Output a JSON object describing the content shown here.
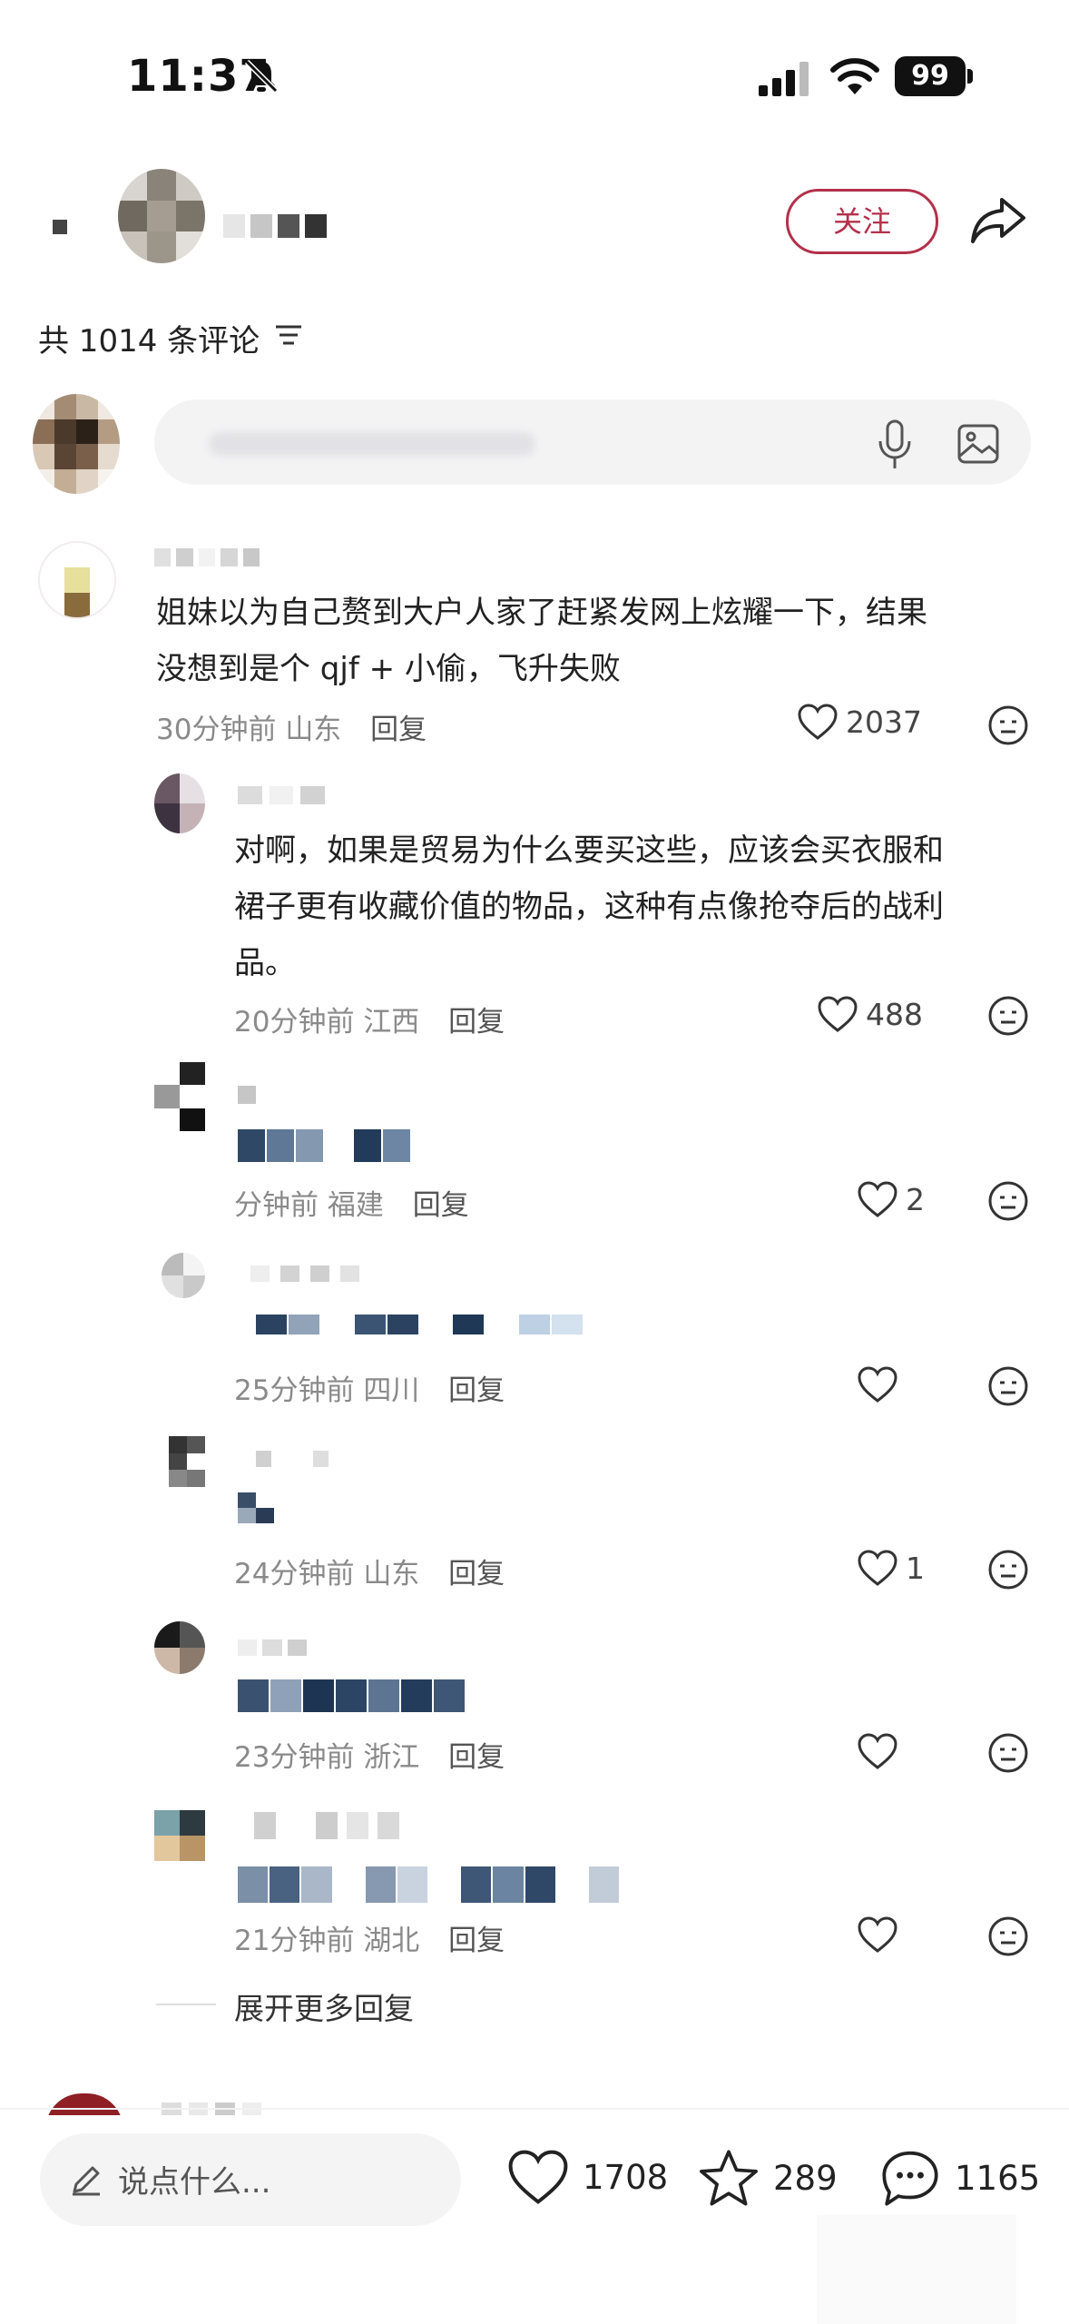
{
  "status": {
    "time": "11:37",
    "battery": "99"
  },
  "header": {
    "follow_label": "关注"
  },
  "comments_header": {
    "count_label": "共 1014 条评论"
  },
  "input": {
    "placeholder": ""
  },
  "comments": [
    {
      "text_line1": "姐妹以为自己赘到大户人家了赶紧发网上炫耀一下，结果",
      "text_line2": "没想到是个 qjf + 小偷，飞升失败",
      "time": "30分钟前",
      "location": "山东",
      "reply": "回复",
      "likes": "2037"
    }
  ],
  "replies": [
    {
      "text_line1": "对啊，如果是贸易为什么要买这些，应该会买衣服和",
      "text_line2": "裙子更有收藏价值的物品，这种有点像抢夺后的战利",
      "text_line3": "品。",
      "time": "20分钟前",
      "location": "江西",
      "reply": "回复",
      "likes": "488"
    },
    {
      "time": "分钟前",
      "location": "福建",
      "reply": "回复",
      "likes": "2"
    },
    {
      "time": "25分钟前",
      "location": "四川",
      "reply": "回复",
      "likes": ""
    },
    {
      "time": "24分钟前",
      "location": "山东",
      "reply": "回复",
      "likes": "1"
    },
    {
      "time": "23分钟前",
      "location": "浙江",
      "reply": "回复",
      "likes": ""
    },
    {
      "time": "21分钟前",
      "location": "湖北",
      "reply": "回复",
      "likes": ""
    }
  ],
  "expand": {
    "label": "展开更多回复"
  },
  "bottom": {
    "say_placeholder": "说点什么...",
    "likes": "1708",
    "stars": "289",
    "comments": "1165"
  },
  "colors": {
    "accent": "#b3314a",
    "text": "#222222",
    "meta": "#8a8a8a"
  }
}
